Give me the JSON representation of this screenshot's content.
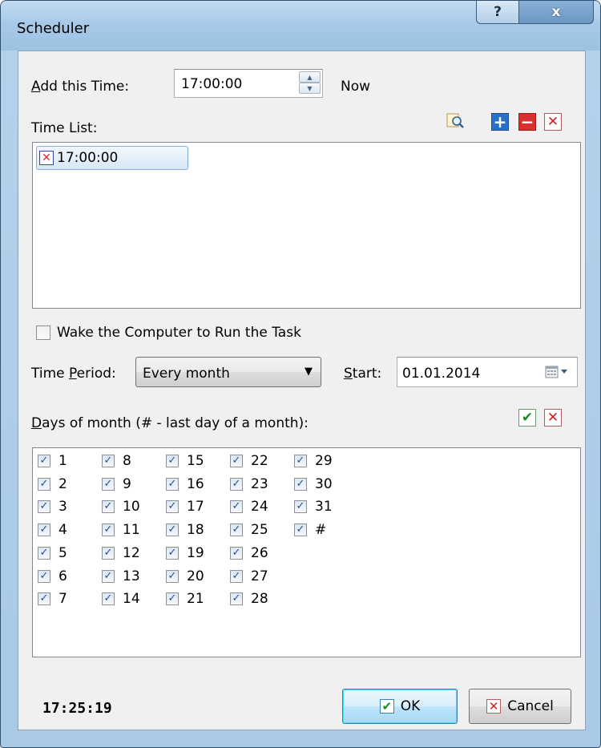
{
  "window": {
    "title": "Scheduler",
    "help_label": "?",
    "close_label": "x"
  },
  "add_time": {
    "label_accel": "A",
    "label_rest": "dd this Time:",
    "value": "17:00:00",
    "now_label": "Now"
  },
  "time_list": {
    "label": "Time List:",
    "items": [
      "17:00:00"
    ],
    "toolbar_icons": [
      "zoom-icon",
      "add-icon",
      "remove-icon",
      "clear-icon"
    ]
  },
  "wake": {
    "label": "Wake the Computer to Run the Task",
    "checked": false
  },
  "period": {
    "label_pre": "Time ",
    "label_accel": "P",
    "label_rest": "eriod:",
    "value": "Every month"
  },
  "start": {
    "label_accel": "S",
    "label_rest": "tart:",
    "value": "01.01.2014"
  },
  "days": {
    "label_accel": "D",
    "label_rest": "ays of month (# - last day of a month):",
    "columns": [
      [
        "1",
        "2",
        "3",
        "4",
        "5",
        "6",
        "7"
      ],
      [
        "8",
        "9",
        "10",
        "11",
        "12",
        "13",
        "14"
      ],
      [
        "15",
        "16",
        "17",
        "18",
        "19",
        "20",
        "21"
      ],
      [
        "22",
        "23",
        "24",
        "25",
        "26",
        "27",
        "28"
      ],
      [
        "29",
        "30",
        "31",
        "#"
      ]
    ],
    "checkmark": "✓"
  },
  "footer": {
    "clock": "17:25:19",
    "ok_label": "OK",
    "cancel_label": "Cancel"
  },
  "colors": {
    "accent": "#2a6fc9",
    "danger": "#d41c1c",
    "success": "#1d8a1d"
  }
}
